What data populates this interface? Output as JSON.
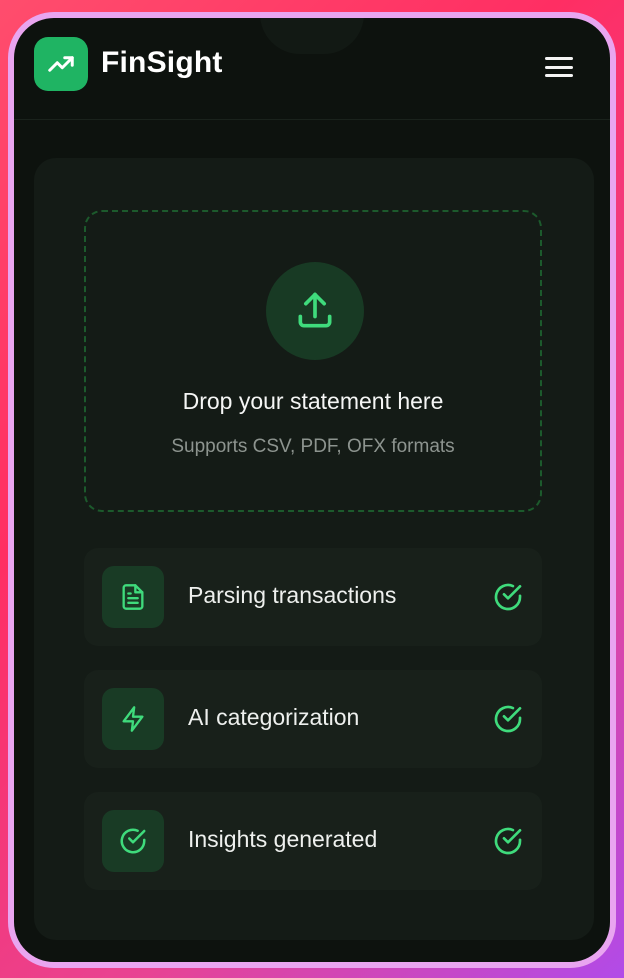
{
  "app": {
    "name": "FinSight",
    "logo_icon": "trending-up-icon",
    "menu_icon": "hamburger-menu-icon"
  },
  "upload": {
    "icon": "upload-icon",
    "title": "Drop your statement here",
    "subtitle": "Supports CSV, PDF, OFX formats"
  },
  "steps": [
    {
      "label": "Parsing transactions",
      "icon": "file-text-icon",
      "status": "complete"
    },
    {
      "label": "AI categorization",
      "icon": "lightning-icon",
      "status": "complete"
    },
    {
      "label": "Insights generated",
      "icon": "check-circle-icon",
      "status": "complete"
    }
  ],
  "colors": {
    "accent": "#1fb463",
    "accent_light": "#4ade80",
    "background": "#0d120e",
    "card": "#141b16"
  }
}
